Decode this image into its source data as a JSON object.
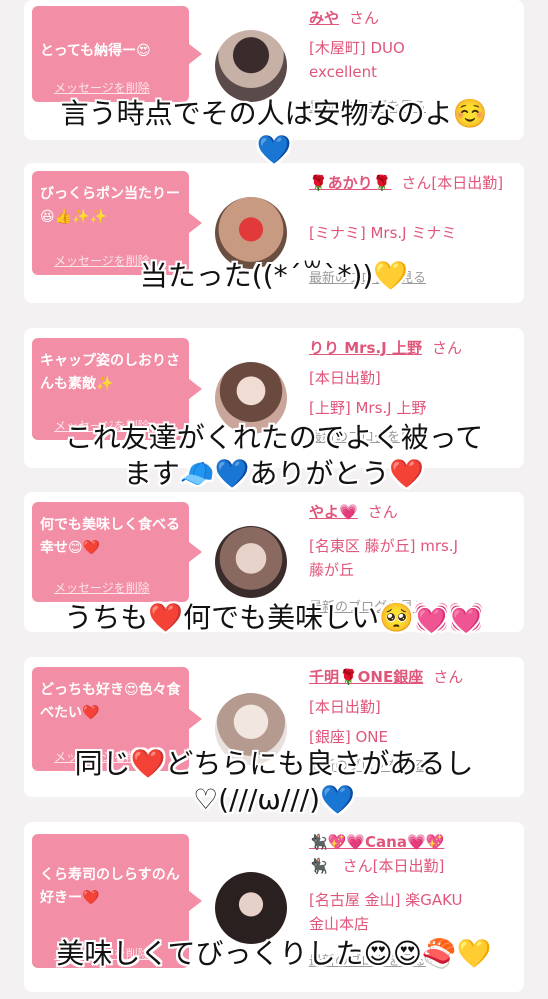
{
  "cards": [
    {
      "bubble_text": "とっても納得ー😍",
      "delete_label": "メッセージを削除",
      "name": "みや",
      "suffix": "さん",
      "line1": "[木屋町] DUO",
      "line2": "excellent",
      "blog_label": "最新のブログを見る",
      "overlay_lines": [
        "言う時点でその人は安物なのよ☺️",
        "💙"
      ]
    },
    {
      "bubble_text": "びっくらポン当たりー😆👍✨✨",
      "delete_label": "メッセージを削除",
      "name": "🌹あかり🌹",
      "suffix": "さん[本日出勤]",
      "line1": "[ミナミ] Mrs.J ミナミ",
      "line2": "",
      "blog_label": "最新のブログを見る",
      "overlay_lines": [
        "当たった((*´꒳`*))💛"
      ]
    },
    {
      "bubble_text": "キャップ姿のしおりさんも素敵✨",
      "delete_label": "メッセージを削除",
      "name": "りり Mrs.J 上野",
      "suffix": "さん",
      "line1": "[本日出勤]",
      "line2": "[上野] Mrs.J 上野",
      "blog_label": "最新のブログを見る",
      "overlay_lines": [
        "これ友達がくれたのでよく被って",
        "ます🧢💙ありがとう❤️"
      ]
    },
    {
      "bubble_text": "何でも美味しく食べる幸せ😊❤️",
      "delete_label": "メッセージを削除",
      "name": "やよ💗",
      "suffix": "さん",
      "line1": "[名東区 藤が丘] mrs.J",
      "line2": "藤が丘",
      "blog_label": "最新のブログを見る",
      "overlay_lines": [
        "うちも❤️何でも美味しい🥺💓💓"
      ]
    },
    {
      "bubble_text": "どっちも好き😍色々食べたい❤️",
      "delete_label": "メッセージを削除",
      "name": "千明🌹ONE銀座",
      "suffix": "さん",
      "line1": "[本日出勤]",
      "line2": "[銀座] ONE",
      "blog_label": "最新のブログを見る",
      "overlay_lines": [
        "同じ❤️どちらにも良さがあるし",
        "♡(///ω///)💙"
      ]
    },
    {
      "bubble_text": "くら寿司のしらすのん好きー❤️",
      "delete_label": "メッセージを削除",
      "name": "🐈‍⬛💖💗Cana💗💖",
      "suffix": "🐈‍⬛　さん[本日出勤]",
      "line1": "[名古屋 金山] 楽GAKU",
      "line2": "金山本店",
      "blog_label": "最新のブログを見る",
      "overlay_lines": [
        "美味しくてびっくりした😍😍🍣💛"
      ]
    }
  ]
}
